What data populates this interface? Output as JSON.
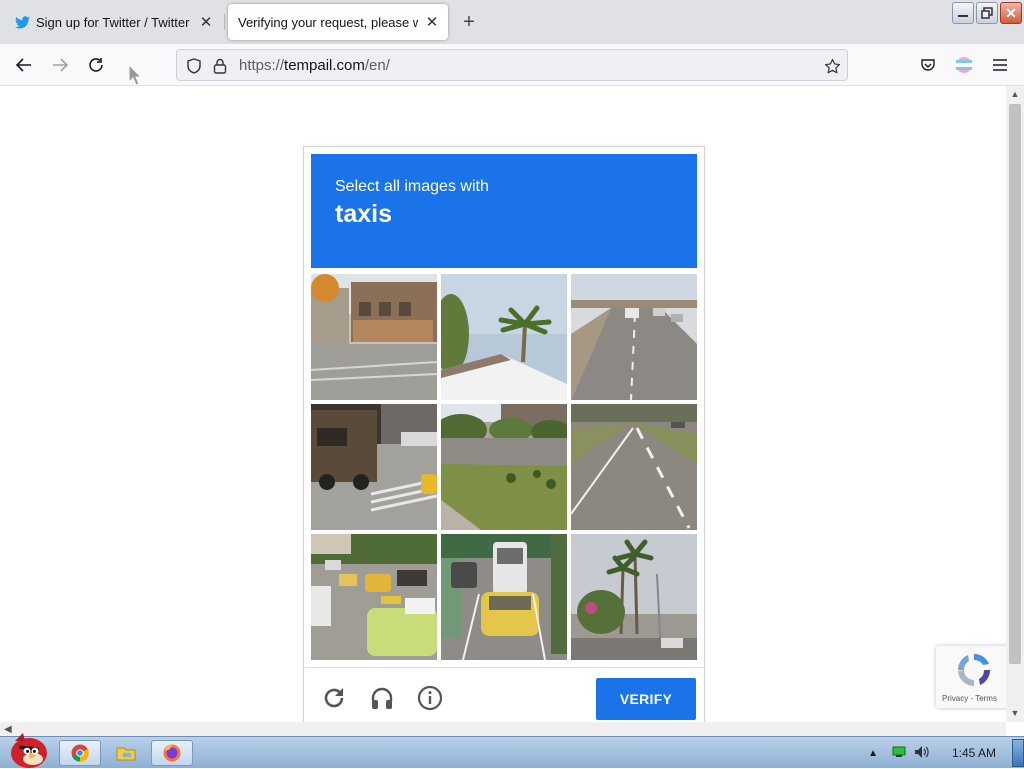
{
  "browser": {
    "tabs": [
      {
        "title": "Sign up for Twitter / Twitter",
        "active": false,
        "favicon": "twitter-bird-icon"
      },
      {
        "title": "Verifying your request, please wait",
        "active": true,
        "favicon": ""
      }
    ],
    "url": {
      "scheme": "https://",
      "host": "tempail.com",
      "path": "/en/"
    }
  },
  "captcha": {
    "prompt": "Select all images with",
    "target": "taxis",
    "verify_label": "VERIFY",
    "tiles": [
      {
        "scene": "street corner with buildings"
      },
      {
        "scene": "palm tree above a roof"
      },
      {
        "scene": "highway with cars"
      },
      {
        "scene": "delivery truck and taxi"
      },
      {
        "scene": "parking lot with trees"
      },
      {
        "scene": "empty road"
      },
      {
        "scene": "street with yellow taxis"
      },
      {
        "scene": "yellow car behind a bus"
      },
      {
        "scene": "palm trees on a street"
      }
    ]
  },
  "recaptcha_badge": {
    "terms": "Privacy - Terms"
  },
  "taskbar": {
    "clock": "1:45 AM"
  },
  "colors": {
    "accent": "#1a73e8",
    "tab_bar": "#dfe1e5",
    "taskbar": "#9dbbdc"
  }
}
